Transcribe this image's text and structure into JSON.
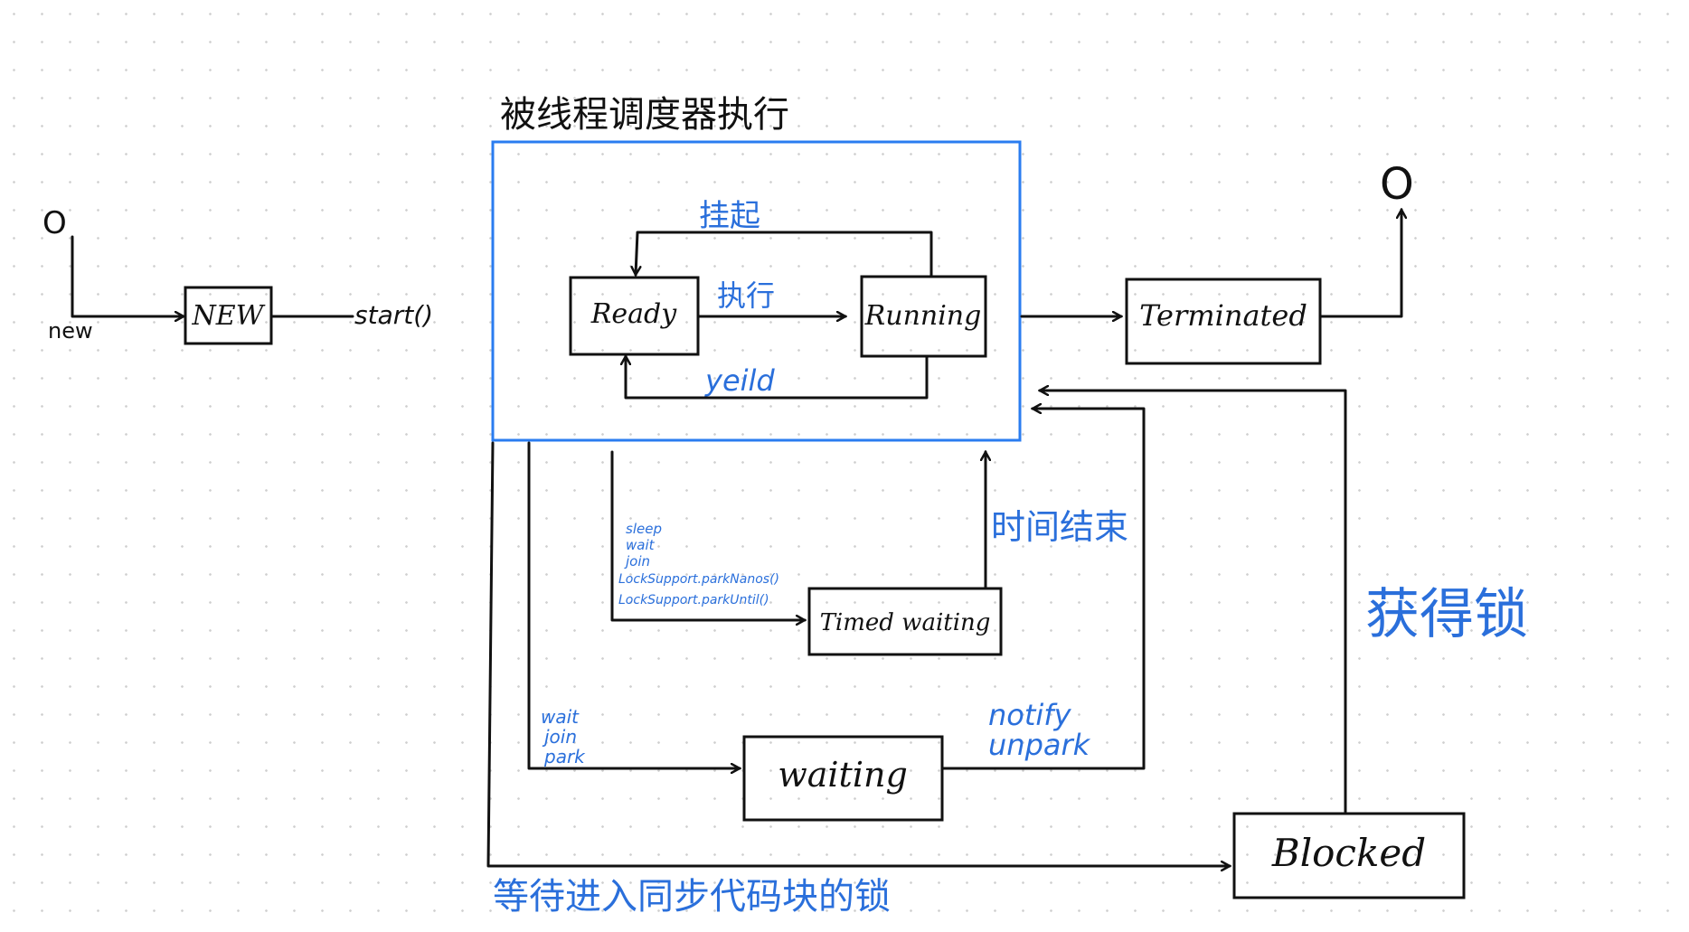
{
  "scheduler_label": "被线程调度器执行",
  "start_marker": "O",
  "end_marker": "O",
  "edge_new_label": "new",
  "edge_start_label": "start()",
  "states": {
    "new": "NEW",
    "ready": "Ready",
    "running": "Running",
    "terminated": "Terminated",
    "timed_waiting": "Timed waiting",
    "waiting": "waiting",
    "blocked": "Blocked"
  },
  "transitions": {
    "suspend": "挂起",
    "execute": "执行",
    "yield": "yeild",
    "time_up": "时间结束",
    "acquire_lock": "获得锁",
    "wait_for_sync_lock": "等待进入同步代码块的锁",
    "to_timed_waiting": [
      "sleep",
      "wait",
      "join",
      "LockSupport.parkNanos()",
      "LockSupport.parkUntil()"
    ],
    "to_waiting": [
      "wait",
      "join",
      "park"
    ],
    "notify": [
      "notify",
      "unpark"
    ]
  },
  "colors": {
    "accent": "#2a7cf0",
    "ink": "#111111"
  }
}
